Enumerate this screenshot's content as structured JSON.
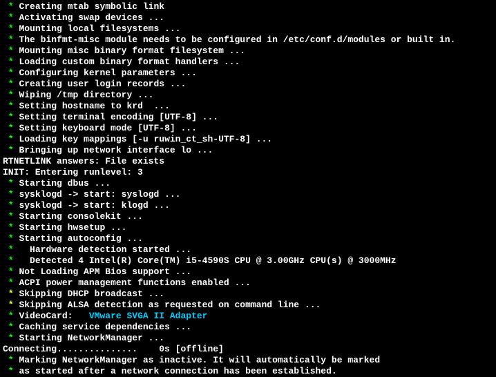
{
  "lines": [
    {
      "type": "star",
      "color": "green",
      "text": "Creating mtab symbolic link"
    },
    {
      "type": "star",
      "color": "green",
      "text": "Activating swap devices ..."
    },
    {
      "type": "star",
      "color": "green",
      "text": "Mounting local filesystems ..."
    },
    {
      "type": "star",
      "color": "green",
      "text": "The binfmt-misc module needs to be configured in /etc/conf.d/modules or built in."
    },
    {
      "type": "star",
      "color": "green",
      "text": "Mounting misc binary format filesystem ..."
    },
    {
      "type": "star",
      "color": "green",
      "text": "Loading custom binary format handlers ..."
    },
    {
      "type": "star",
      "color": "green",
      "text": "Configuring kernel parameters ..."
    },
    {
      "type": "star",
      "color": "green",
      "text": "Creating user login records ..."
    },
    {
      "type": "star",
      "color": "green",
      "text": "Wiping /tmp directory ..."
    },
    {
      "type": "star",
      "color": "green",
      "text": "Setting hostname to krd  ..."
    },
    {
      "type": "star",
      "color": "green",
      "text": "Setting terminal encoding [UTF-8] ..."
    },
    {
      "type": "star",
      "color": "green",
      "text": "Setting keyboard mode [UTF-8] ..."
    },
    {
      "type": "star",
      "color": "green",
      "text": "Loading key mappings [-u ruwin_ct_sh-UTF-8] ..."
    },
    {
      "type": "star",
      "color": "green",
      "text": "Bringing up network interface lo ..."
    },
    {
      "type": "plain",
      "text": "RTNETLINK answers: File exists"
    },
    {
      "type": "plain",
      "text": "INIT: Entering runlevel: 3"
    },
    {
      "type": "star",
      "color": "green",
      "text": "Starting dbus ..."
    },
    {
      "type": "star",
      "color": "green",
      "text": "sysklogd -> start: syslogd ..."
    },
    {
      "type": "star",
      "color": "green",
      "text": "sysklogd -> start: klogd ..."
    },
    {
      "type": "star",
      "color": "green",
      "text": "Starting consolekit ..."
    },
    {
      "type": "star",
      "color": "green",
      "text": "Starting hwsetup ..."
    },
    {
      "type": "star",
      "color": "green",
      "text": "Starting autoconfig ..."
    },
    {
      "type": "star",
      "color": "green",
      "text": "  Hardware detection started ..."
    },
    {
      "type": "star",
      "color": "green",
      "text": "  Detected 4 Intel(R) Core(TM) i5-4590S CPU @ 3.00GHz CPU(s) @ 3000MHz"
    },
    {
      "type": "star",
      "color": "green",
      "text": "Not Loading APM Bios support ..."
    },
    {
      "type": "star",
      "color": "green",
      "text": "ACPI power management functions enabled ..."
    },
    {
      "type": "star",
      "color": "yellow",
      "text": "Skipping DHCP broadcast ..."
    },
    {
      "type": "star",
      "color": "yellow",
      "text": "Skipping ALSA detection as requested on command line ..."
    },
    {
      "type": "videocard",
      "label": "VideoCard:   ",
      "adapter": "VMware SVGA II Adapter"
    },
    {
      "type": "star",
      "color": "green",
      "text": "Caching service dependencies ..."
    },
    {
      "type": "star",
      "color": "green",
      "text": "Starting NetworkManager ..."
    },
    {
      "type": "plain",
      "text": "Connecting...............    0s [offline]"
    },
    {
      "type": "star",
      "color": "green",
      "text": "Marking NetworkManager as inactive. It will automatically be marked"
    },
    {
      "type": "star",
      "color": "green",
      "text": "as started after a network connection has been established."
    }
  ]
}
